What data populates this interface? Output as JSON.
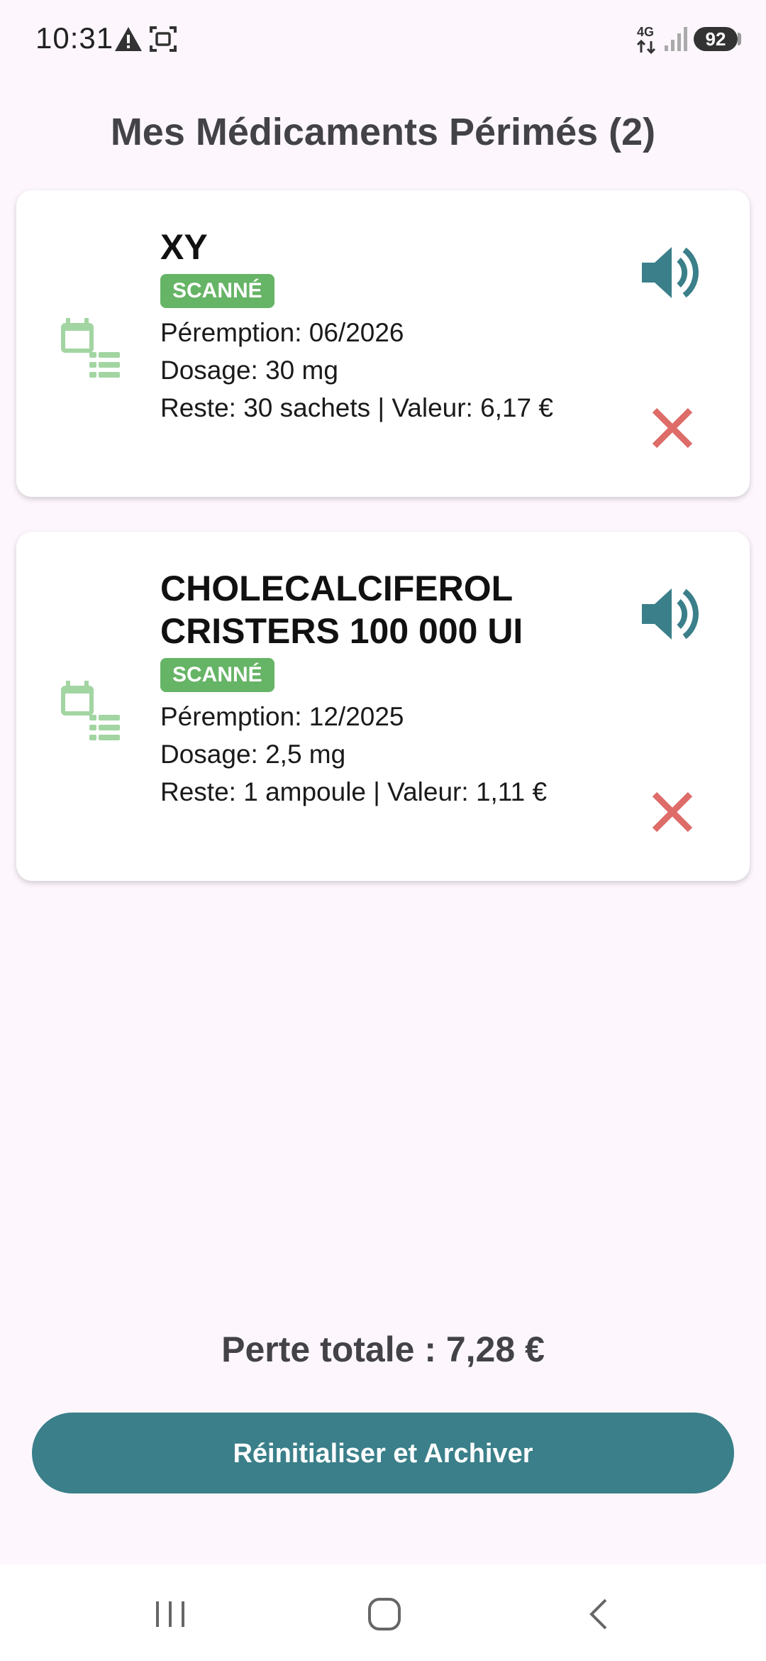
{
  "status_bar": {
    "time": "10:31",
    "network": "4G",
    "battery": "92",
    "icons": [
      "warning-icon",
      "screenshot-icon",
      "network-4g-icon",
      "signal-icon",
      "battery-icon"
    ]
  },
  "page": {
    "title": "Mes Médicaments Périmés (2)"
  },
  "medications": [
    {
      "name": "XY",
      "badge": "SCANNÉ",
      "expiry": "Péremption: 06/2026",
      "dosage": "Dosage: 30 mg",
      "remaining": "Reste: 30 sachets | Valeur: 6,17 €"
    },
    {
      "name_line1": "CHOLECALCIFEROL",
      "name_line2": "CRISTERS 100 000 UI",
      "badge": "SCANNÉ",
      "expiry": "Péremption: 12/2025",
      "dosage": "Dosage: 2,5 mg",
      "remaining": "Reste: 1 ampoule | Valeur: 1,11 €"
    }
  ],
  "summary": {
    "total": "Perte totale : 7,28 €"
  },
  "actions": {
    "archive_label": "Réinitialiser et Archiver"
  },
  "colors": {
    "accent": "#3a7f89",
    "badge": "#66b466",
    "delete": "#d9534f",
    "background": "#fdf7fd"
  }
}
